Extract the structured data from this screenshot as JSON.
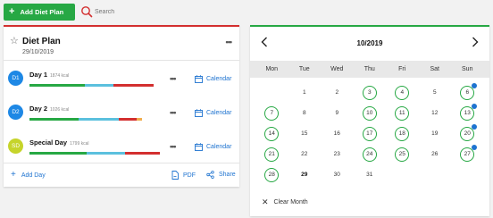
{
  "toolbar": {
    "add_plan_label": "Add Diet Plan",
    "search_placeholder": "Search"
  },
  "plan": {
    "title": "Diet Plan",
    "date": "29/10/2019",
    "days": [
      {
        "initials": "D1",
        "name": "Day 1",
        "kcal": "1874 kcal",
        "avatar_color": "#1e88e5",
        "macros": [
          0.43,
          0.22,
          0.31,
          0.0
        ],
        "calendar_label": "Calendar"
      },
      {
        "initials": "D2",
        "name": "Day 2",
        "kcal": "1026 kcal",
        "avatar_color": "#1e88e5",
        "macros": [
          0.38,
          0.31,
          0.14,
          0.04
        ],
        "calendar_label": "Calendar"
      },
      {
        "initials": "SD",
        "name": "Special Day",
        "kcal": "1799 kcal",
        "avatar_color": "#c6d42b",
        "macros": [
          0.44,
          0.3,
          0.27,
          0.0
        ],
        "calendar_label": "Calendar"
      }
    ],
    "macro_colors": [
      "#27a844",
      "#5bc0de",
      "#d32f2f",
      "#f0ad4e"
    ],
    "footer": {
      "add_day_label": "Add Day",
      "pdf_label": "PDF",
      "share_label": "Share"
    }
  },
  "calendar": {
    "month_label": "10/2019",
    "weekdays": [
      "Mon",
      "Tue",
      "Wed",
      "Thu",
      "Fri",
      "Sat",
      "Sun"
    ],
    "leading_blanks": 1,
    "days_in_month": 31,
    "planned_days": [
      3,
      4,
      6,
      7,
      10,
      11,
      13,
      14,
      17,
      18,
      20,
      21,
      24,
      25,
      27,
      28
    ],
    "dotted_days": [
      6,
      13,
      20,
      27
    ],
    "today": 29,
    "clear_label": "Clear Month"
  }
}
